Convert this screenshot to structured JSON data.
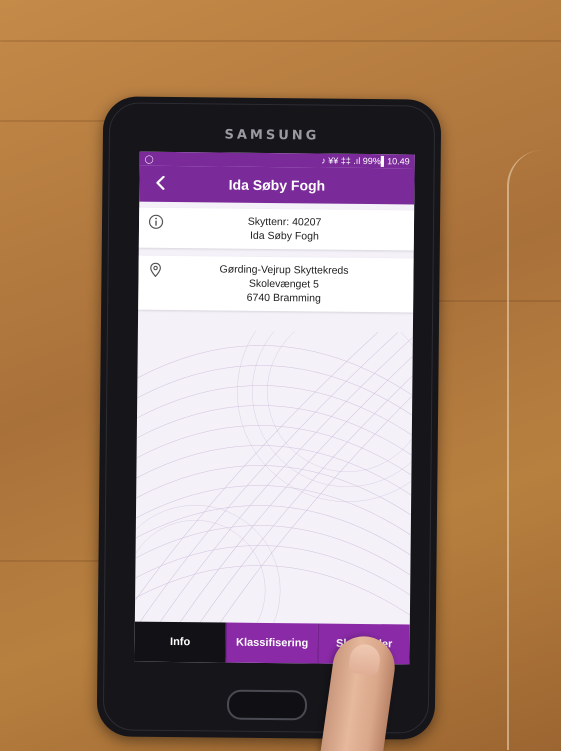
{
  "device": {
    "brand_text": "SAMSUNG"
  },
  "status_bar": {
    "left_icon": "notification-icon",
    "right_text": "♪ ¥¥ ‡‡ .ıl 99%▌10.49",
    "battery": "99%",
    "time": "10.49"
  },
  "app_bar": {
    "back_icon": "chevron-left-icon",
    "title": "Ida Søby Fogh"
  },
  "info_card": {
    "icon": "info-icon",
    "line1": "Skyttenr: 40207",
    "line2": "Ida Søby Fogh"
  },
  "location_card": {
    "icon": "location-pin-icon",
    "line1": "Gørding-Vejrup Skyttekreds",
    "line2": "Skolevænget 5",
    "line3": "6740 Bramming"
  },
  "tabs": [
    {
      "label": "Info",
      "active": true
    },
    {
      "label": "Klassifisering",
      "active": false
    },
    {
      "label": "Skydetider",
      "active": false
    }
  ],
  "colors": {
    "accent": "#7b2a9a",
    "tab_active": "#111116",
    "tab_inactive": "#8a2aa6"
  }
}
